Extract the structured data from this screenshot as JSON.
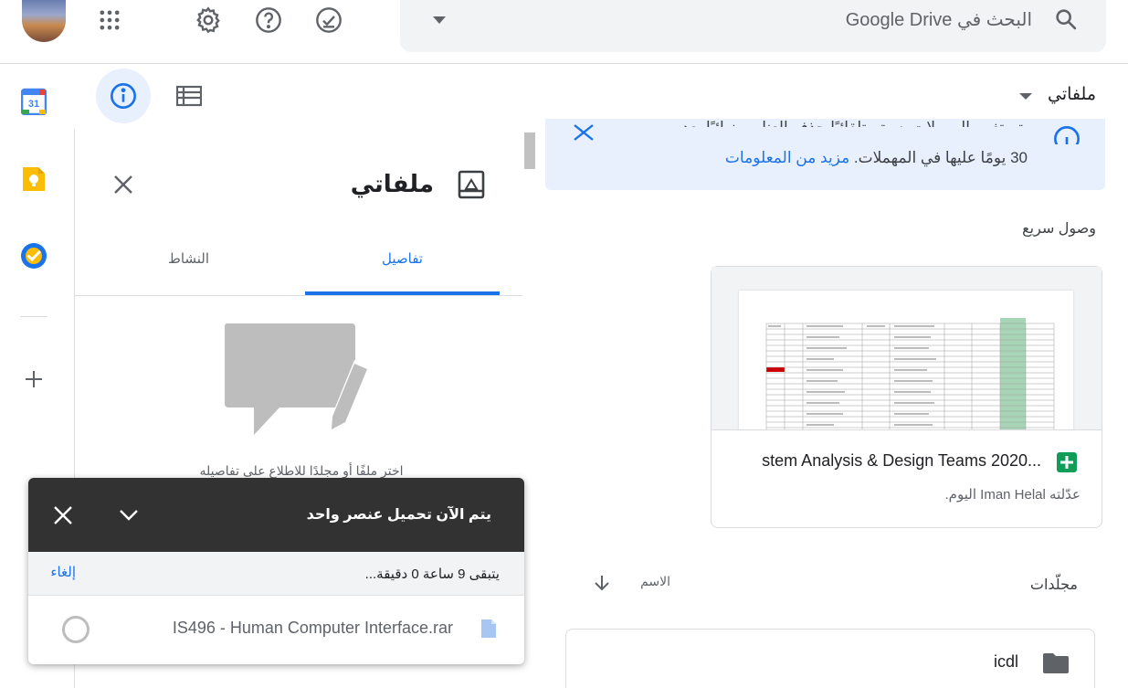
{
  "header": {
    "search_placeholder": "البحث في Google Drive"
  },
  "info_pane": {
    "title": "ملفاتي",
    "tabs": [
      {
        "label": "تفاصيل",
        "active": true
      },
      {
        "label": "النشاط",
        "active": false
      }
    ],
    "hint": "اختر ملفًا أو مجلدًا للاطلاع على تفاصيله"
  },
  "main": {
    "breadcrumb": "ملفاتي",
    "banner": {
      "line1": "تم تغيير المهملات. سيتم تلقائيًا حذف العناصر نهائيًا بعد مرور",
      "line2": "30 يومًا عليها في المهملات.",
      "link": "مزيد من المعلومات"
    },
    "quick_access": {
      "title": "وصول سريع",
      "file": {
        "title": "stem Analysis & Design Teams 2020...",
        "subtitle": "عدّلته Iman Helal اليوم."
      }
    },
    "sort": {
      "folders_label": "مجلّدات",
      "name_label": "الاسم"
    },
    "folders": [
      {
        "name": "icdl"
      }
    ]
  },
  "upload": {
    "title": "يتم الآن تحميل عنصر واحد",
    "remaining": "يتبقى 9 ساعة 0 دقيقة...",
    "cancel_label": "إلغاء",
    "file_name": "IS496 - Human Computer Interface.rar"
  },
  "colors": {
    "accent": "#1a73e8",
    "banner_bg": "#e8f0fe",
    "upload_header": "#323232",
    "sheets_green": "#0f9d58"
  },
  "icons": {
    "apps": "apps-grid-icon",
    "settings": "gear-icon",
    "help": "help-icon",
    "ready_offline": "check-circle-icon",
    "search": "search-icon"
  }
}
